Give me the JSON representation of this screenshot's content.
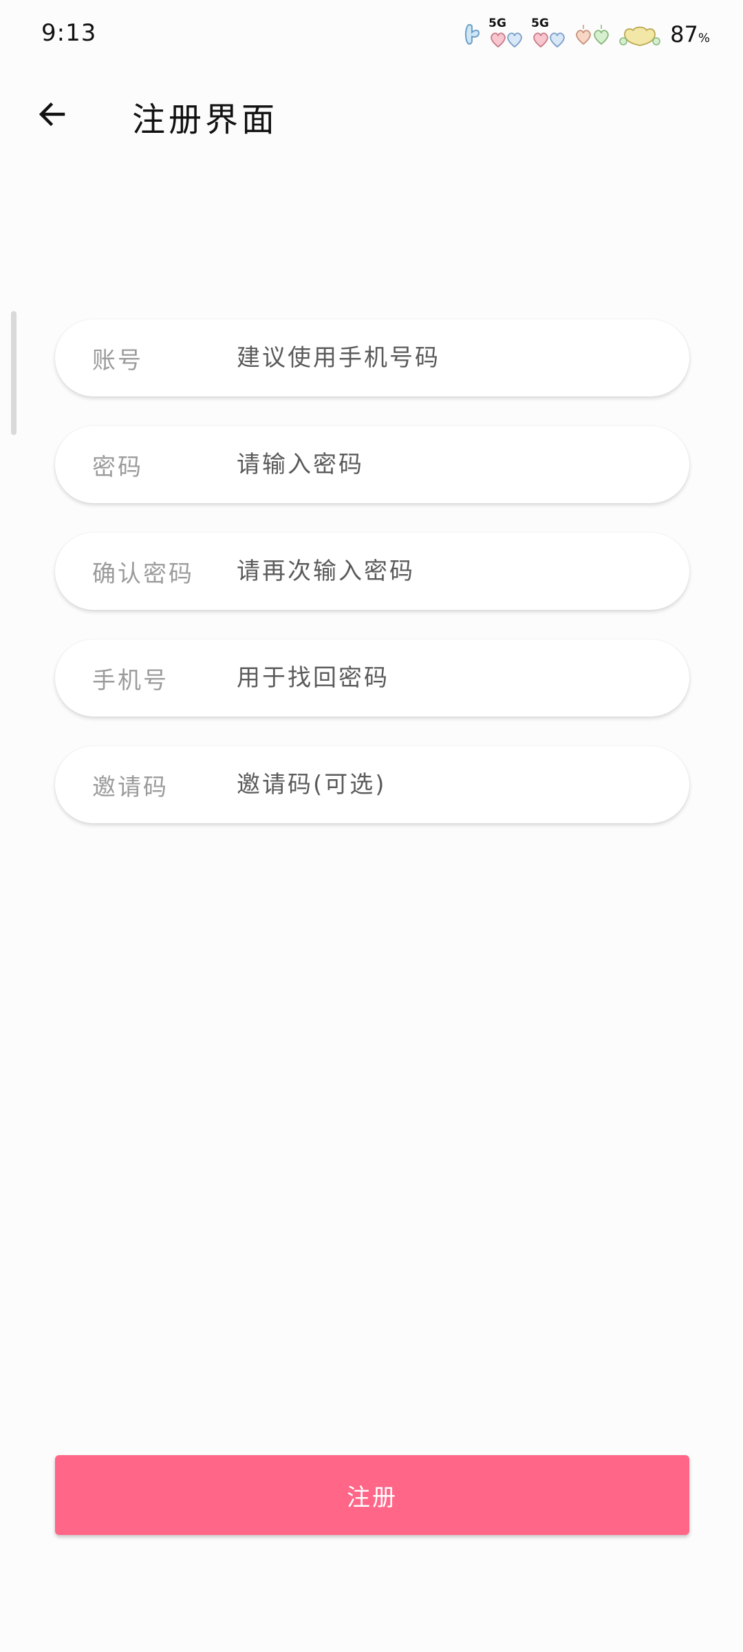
{
  "status_bar": {
    "time": "9:13",
    "network_label_1": "5G",
    "network_label_2": "5G",
    "battery": "87",
    "battery_unit": "%",
    "icons": [
      "custom-status-icon",
      "signal-heart-icon",
      "signal-heart-icon",
      "love-hearts-icon",
      "battery-heart-icon"
    ]
  },
  "app_bar": {
    "back_icon": "arrow-left-icon",
    "title": "注册界面"
  },
  "form": {
    "fields": [
      {
        "label": "账号",
        "placeholder": "建议使用手机号码",
        "value": ""
      },
      {
        "label": "密码",
        "placeholder": "请输入密码",
        "value": ""
      },
      {
        "label": "确认密码",
        "placeholder": "请再次输入密码",
        "value": ""
      },
      {
        "label": "手机号",
        "placeholder": "用于找回密码",
        "value": ""
      },
      {
        "label": "邀请码",
        "placeholder": "邀请码(可选)",
        "value": ""
      }
    ]
  },
  "register_button": {
    "label": "注册"
  },
  "colors": {
    "accent": "#ff6688",
    "background": "#fcfcfc",
    "field_background": "#ffffff",
    "label_text": "#9b9b9b"
  }
}
